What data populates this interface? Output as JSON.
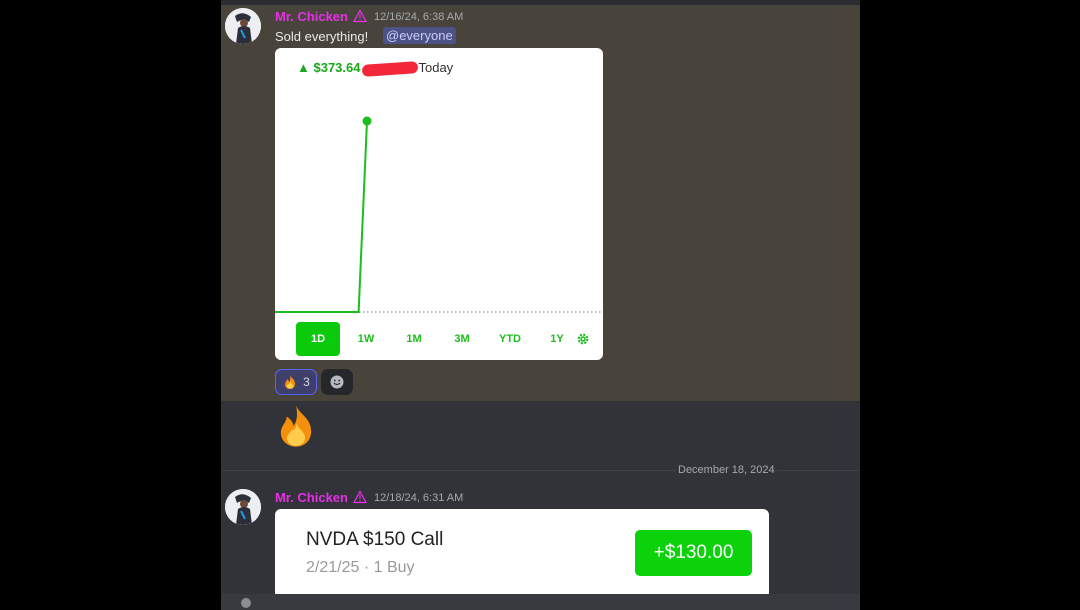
{
  "messages": [
    {
      "username": "Mr. Chicken",
      "timestamp": "12/16/24, 6:38 AM",
      "text": "Sold everything!",
      "mention": "@everyone",
      "chart": {
        "change": "▲ $373.64",
        "period": "Today",
        "ranges": [
          "1D",
          "1W",
          "1M",
          "3M",
          "YTD",
          "1Y"
        ],
        "active_range": "1D"
      },
      "reactions": [
        {
          "emoji": "fire-emoji",
          "count": "3"
        },
        {
          "emoji": "add-reaction-icon"
        }
      ]
    },
    {
      "emoji_message": "fire-emoji"
    },
    {
      "username": "Mr. Chicken",
      "timestamp": "12/18/24, 6:31 AM",
      "trade": {
        "title": "NVDA $150 Call",
        "subtitle": "2/21/25 · 1 Buy",
        "gain": "+$130.00"
      }
    }
  ],
  "date_divider": "December 18, 2024",
  "colors": {
    "username": "#e62fe6",
    "gain_green": "#0bd20b",
    "chart_green": "#1ebd1e",
    "highlight_bg": "#48443c",
    "mention_bg": "#4c5286"
  },
  "chart_data": {
    "type": "line",
    "title": "",
    "series": [
      {
        "values": [
          0,
          0,
          0,
          0,
          0,
          0,
          0,
          0,
          0,
          0,
          0,
          373.64
        ]
      }
    ],
    "note_marker_last_point": true,
    "ylim": [
      0,
      450
    ]
  }
}
